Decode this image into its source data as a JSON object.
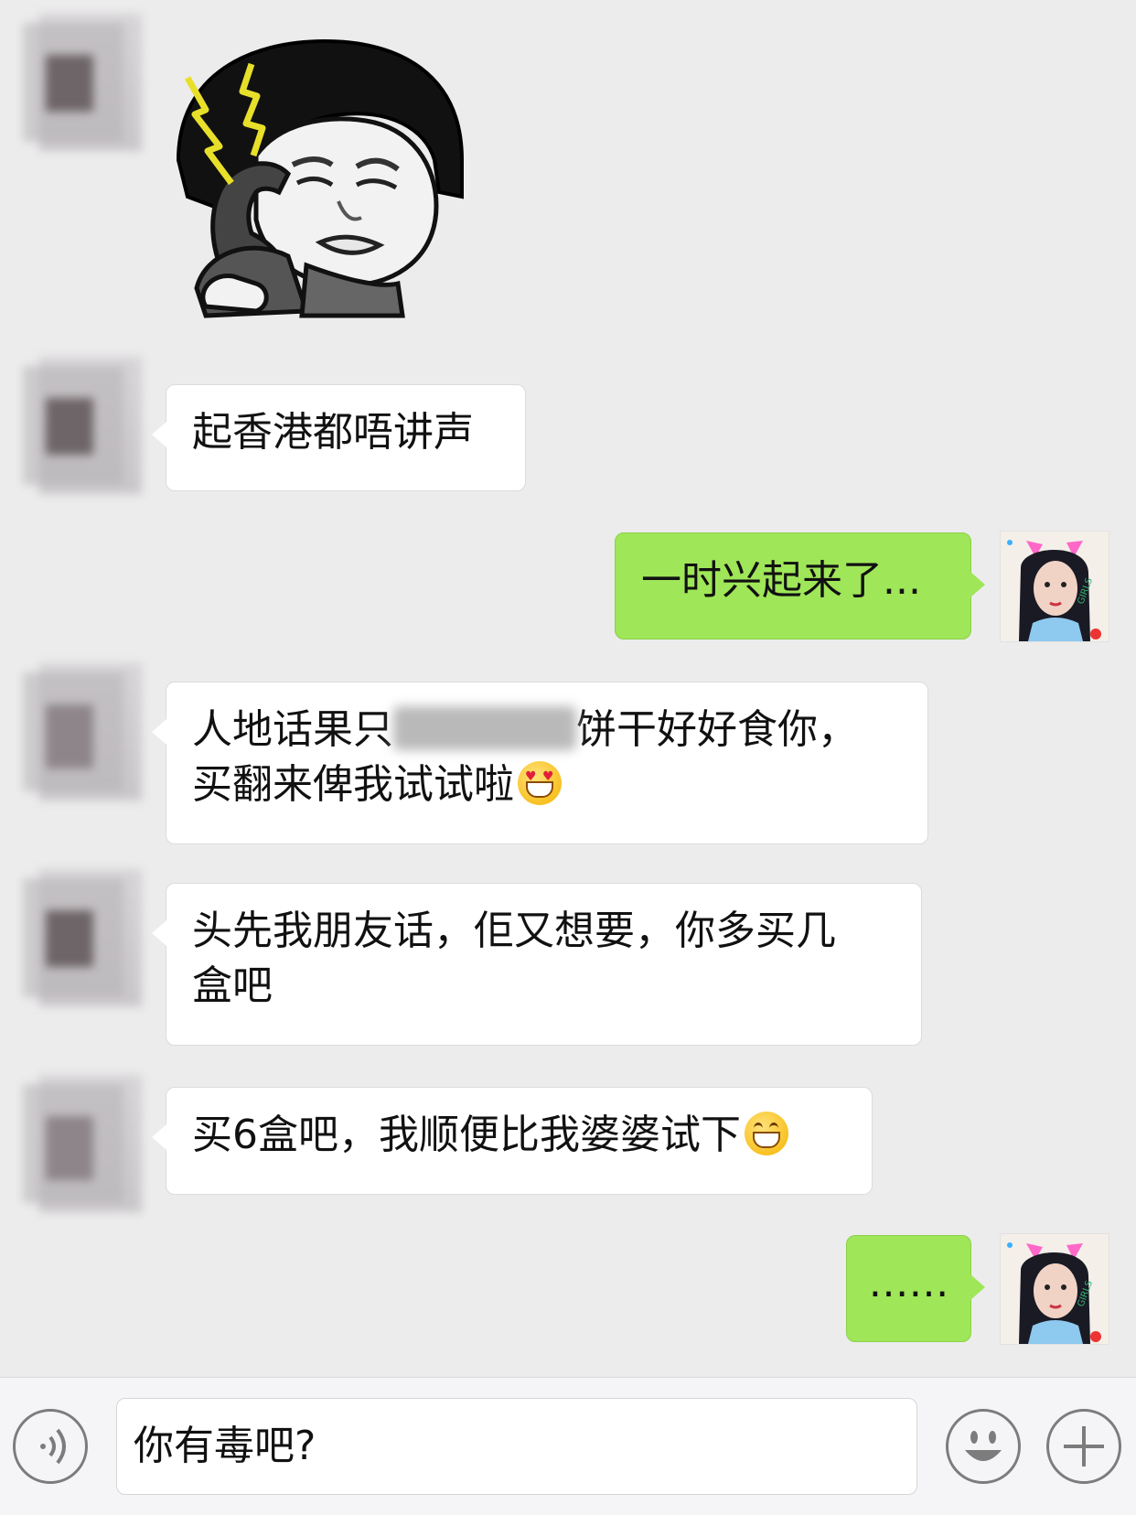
{
  "messages": [
    {
      "from": "other",
      "type": "sticker",
      "sticker": "crying-bowlcut-phone-sticker"
    },
    {
      "from": "other",
      "type": "text",
      "text": "起香港都唔讲声"
    },
    {
      "from": "self",
      "type": "text",
      "text": "一时兴起来了..."
    },
    {
      "from": "other",
      "type": "text",
      "line1a": "人地话果只",
      "line1b": "饼干好好食你，",
      "line2": "买翻来俾我试试啦",
      "emoji": "heart-eyes-emoji"
    },
    {
      "from": "other",
      "type": "text",
      "line1": "头先我朋友话，佢又想要，你多买几",
      "line2": "盒吧"
    },
    {
      "from": "other",
      "type": "text",
      "text": "买6盒吧，我顺便比我婆婆试下",
      "emoji": "grinning-emoji"
    },
    {
      "from": "self",
      "type": "text",
      "text": "……"
    }
  ],
  "self_avatar": {
    "badge_text": "GIRLS"
  },
  "input": {
    "value": "你有毒吧?"
  },
  "colors": {
    "background": "#ececec",
    "self_bubble": "#9fe658",
    "other_bubble": "#ffffff"
  }
}
